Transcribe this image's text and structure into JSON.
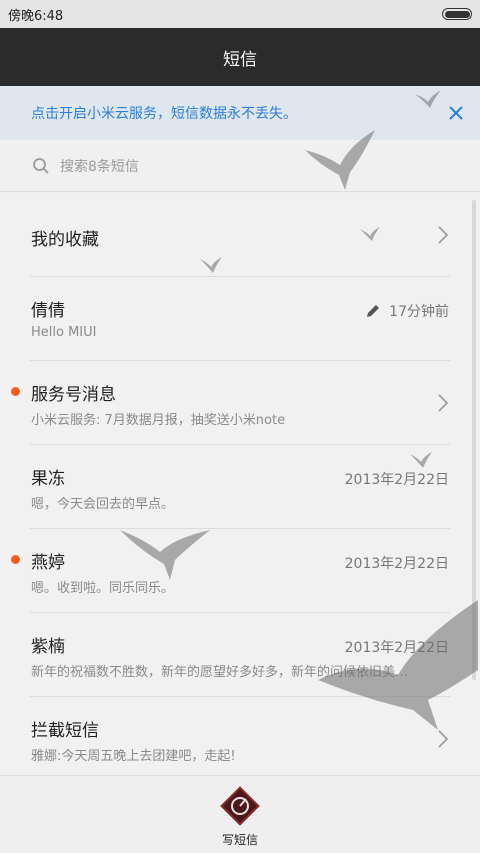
{
  "status_bar": {
    "time": "傍晚6:48"
  },
  "title_bar": {
    "title": "短信"
  },
  "banner": {
    "text": "点击开启小米云服务，短信数据永不丢失。",
    "close": "×"
  },
  "search": {
    "placeholder": "搜索8条短信"
  },
  "conversations": [
    {
      "name": "我的收藏",
      "preview": "",
      "time": "",
      "unread": false,
      "chevron": true
    },
    {
      "name": "倩倩",
      "preview": "Hello MIUI",
      "time": "17分钟前",
      "unread": false,
      "chevron": false,
      "draft": true
    },
    {
      "name": "服务号消息",
      "preview": "小米云服务: 7月数据月报，抽奖送小米note",
      "time": "",
      "unread": true,
      "chevron": true
    },
    {
      "name": "果冻",
      "preview": "嗯，今天会回去的早点。",
      "time": "2013年2月22日",
      "unread": false,
      "chevron": false
    },
    {
      "name": "燕婷",
      "preview": "嗯。收到啦。同乐同乐。",
      "time": "2013年2月22日",
      "unread": true,
      "chevron": false
    },
    {
      "name": "紫楠",
      "preview": "新年的祝福数不胜数，新年的愿望好多好多，新年的问候依旧美…",
      "time": "2013年2月22日",
      "unread": false,
      "chevron": false
    },
    {
      "name": "拦截短信",
      "preview": "雅娜:今天周五晚上去团建吧，走起!",
      "time": "",
      "unread": false,
      "chevron": true
    }
  ],
  "bottom_bar": {
    "compose_label": "写短信"
  },
  "colors": {
    "accent": "#2a7fd6",
    "unread": "#ff5a1f",
    "titlebar": "#2b2b2b"
  }
}
